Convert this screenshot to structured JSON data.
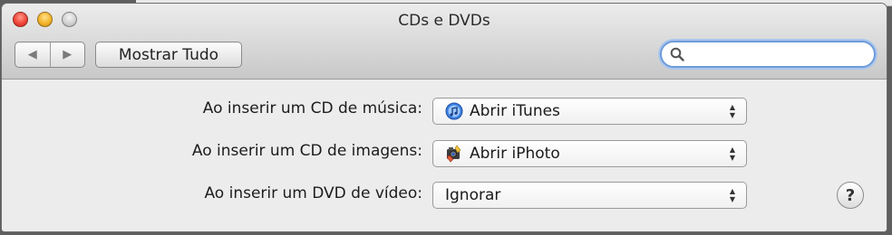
{
  "window": {
    "title": "CDs e DVDs"
  },
  "toolbar": {
    "back_icon": "back-arrow-icon",
    "forward_icon": "forward-arrow-icon",
    "show_all_label": "Mostrar Tudo",
    "search": {
      "value": "",
      "placeholder": ""
    }
  },
  "settings": [
    {
      "label": "Ao inserir um CD de música:",
      "value": "Abrir iTunes",
      "icon": "itunes-icon"
    },
    {
      "label": "Ao inserir um CD de imagens:",
      "value": "Abrir iPhoto",
      "icon": "iphoto-icon"
    },
    {
      "label": "Ao inserir um DVD de vídeo:",
      "value": "Ignorar",
      "icon": ""
    }
  ],
  "help": {
    "label": "?"
  }
}
